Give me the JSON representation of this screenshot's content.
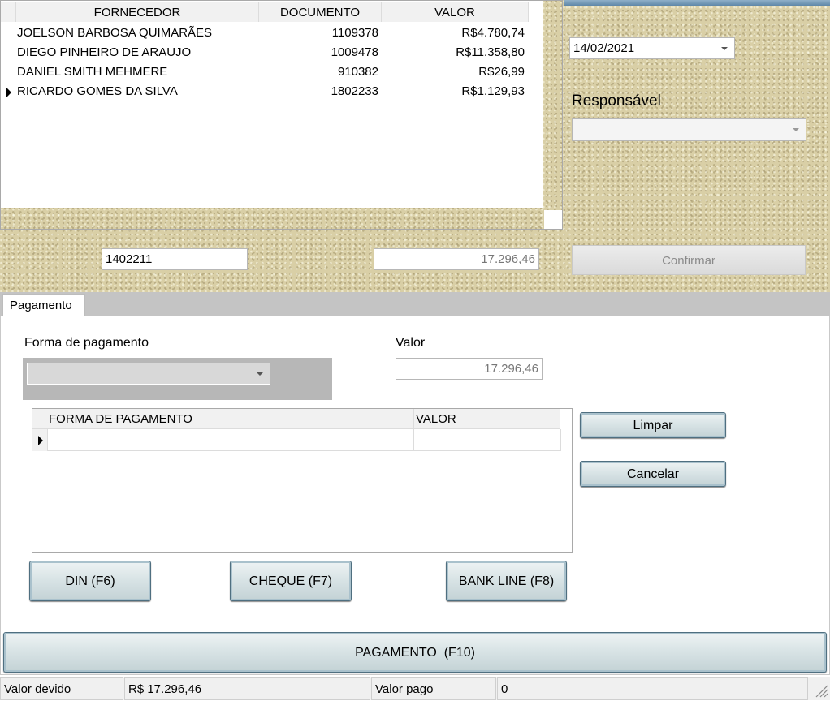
{
  "top_grid": {
    "columns": [
      "FORNECEDOR",
      "DOCUMENTO",
      "VALOR"
    ],
    "rows": [
      {
        "fornecedor": "JOELSON BARBOSA QUIMARÃES",
        "documento": "1109378",
        "valor": "R$4.780,74",
        "current": false
      },
      {
        "fornecedor": "DIEGO PINHEIRO DE ARAUJO",
        "documento": "1009478",
        "valor": "R$11.358,80",
        "current": false
      },
      {
        "fornecedor": "DANIEL SMITH MEHMERE",
        "documento": "910382",
        "valor": "R$26,99",
        "current": false
      },
      {
        "fornecedor": "RICARDO GOMES DA SILVA",
        "documento": "1802233",
        "valor": "R$1.129,93",
        "current": true
      }
    ]
  },
  "date_select": {
    "value": "14/02/2021"
  },
  "responsavel": {
    "label": "Responsável",
    "value": ""
  },
  "document_field": {
    "value": "1402211"
  },
  "total_field": {
    "value": "17.296,46"
  },
  "confirm_button": {
    "label": "Confirmar"
  },
  "tabs": [
    {
      "label": "Pagamento"
    }
  ],
  "payment": {
    "forma_label": "Forma de pagamento",
    "forma_value": "",
    "valor_label": "Valor",
    "valor_value": "17.296,46",
    "grid_columns": [
      "FORMA DE PAGAMENTO",
      "VALOR"
    ],
    "limpar_label": "Limpar",
    "cancelar_label": "Cancelar",
    "din_label": "DIN (F6)",
    "cheque_label": "CHEQUE (F7)",
    "bankline_label": "BANK LINE (F8)",
    "pagamento_label": "PAGAMENTO  (F10)"
  },
  "status_bar": {
    "valor_devido_label": "Valor devido",
    "valor_devido_value": "R$ 17.296,46",
    "valor_pago_label": "Valor pago",
    "valor_pago_value": "0"
  },
  "colors": {
    "sand": "#d9cfa6",
    "button_border": "#4f6f80",
    "tab_strip": "#c4c4c4"
  }
}
